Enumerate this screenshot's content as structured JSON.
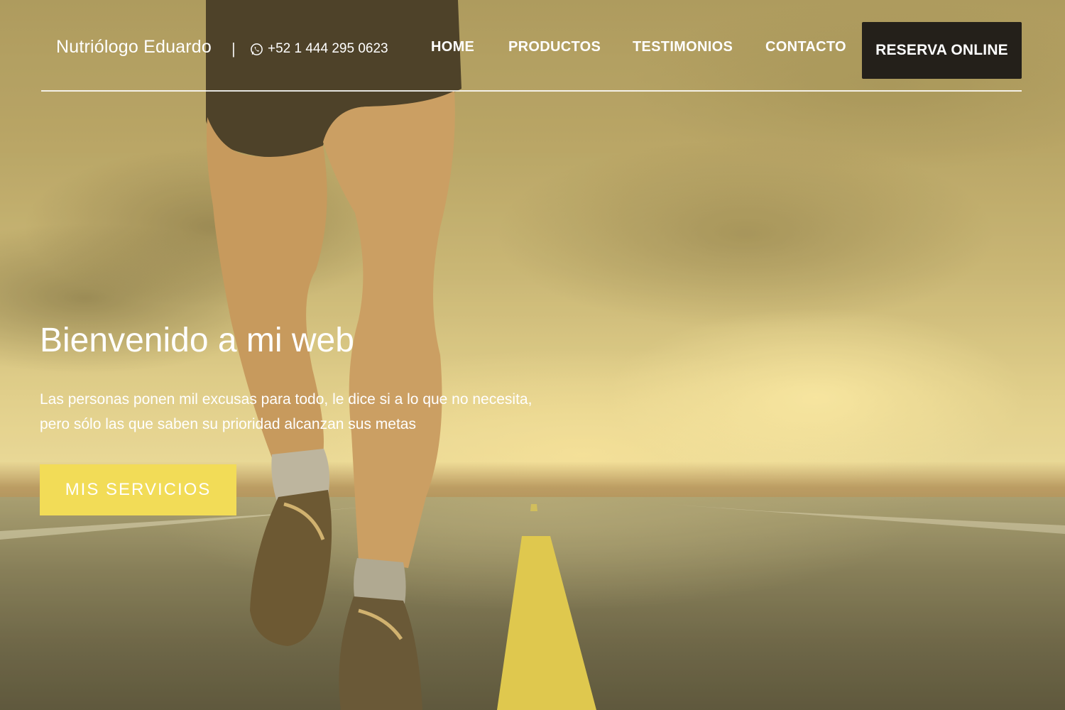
{
  "header": {
    "brand": "Nutriólogo Eduardo",
    "separator": "|",
    "phone": "+52 1 444 295 0623",
    "phone_icon": "whatsapp-icon",
    "nav": [
      {
        "label": "HOME"
      },
      {
        "label": "PRODUCTOS"
      },
      {
        "label": "TESTIMONIOS"
      },
      {
        "label": "CONTACTO"
      }
    ],
    "reserve_label": "RESERVA ONLINE"
  },
  "hero": {
    "title": "Bienvenido a mi web",
    "text_line1": "Las personas ponen mil excusas para todo, le dice si a lo que no necesita,",
    "text_line2": "pero sólo las que saben su prioridad alcanzan sus metas",
    "cta_label": "MIS SERVICIOS",
    "background_image": "runner-on-road"
  },
  "colors": {
    "cta_background": "#f2dc57",
    "reserve_background": "#24201a",
    "text": "#ffffff"
  }
}
